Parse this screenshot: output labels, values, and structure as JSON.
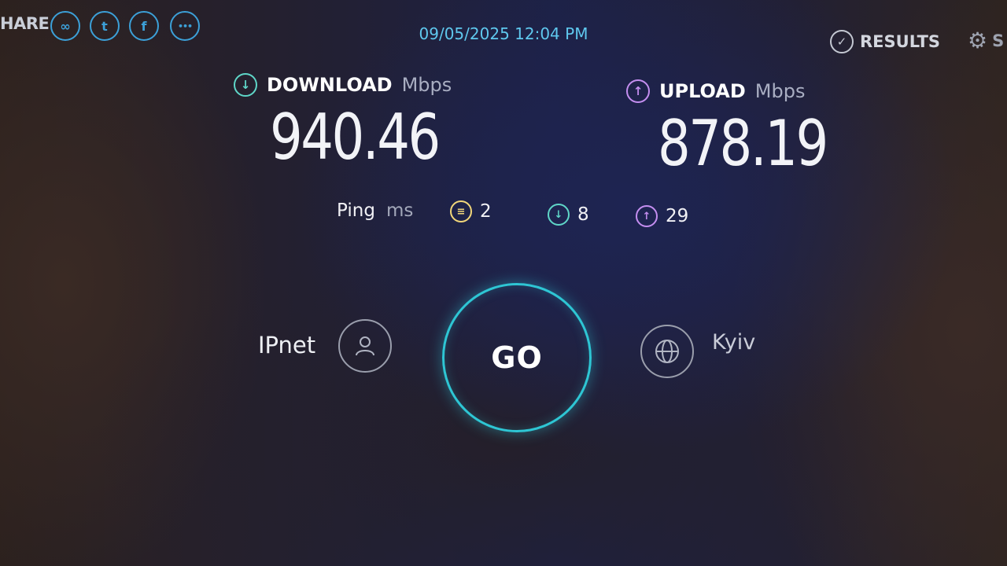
{
  "header": {
    "share_label": "HARE",
    "share_icons": [
      {
        "name": "link-icon",
        "glyph": "∞"
      },
      {
        "name": "twitter-icon",
        "glyph": "t"
      },
      {
        "name": "facebook-icon",
        "glyph": "f"
      },
      {
        "name": "more-icon",
        "glyph": "•••"
      }
    ],
    "timestamp": "09/05/2025 12:04 PM",
    "results_label": "RESULTS",
    "settings_label": "S"
  },
  "download": {
    "label": "DOWNLOAD",
    "unit": "Mbps",
    "value": "940.46"
  },
  "upload": {
    "label": "UPLOAD",
    "unit": "Mbps",
    "value": "878.19"
  },
  "ping": {
    "label": "Ping",
    "unit": "ms",
    "idle": "2",
    "download": "8",
    "upload": "29"
  },
  "server": {
    "provider": "IPnet",
    "go_label": "GO",
    "city": "Kyiv"
  },
  "colors": {
    "download_accent": "#5fd6c8",
    "upload_accent": "#c48ef0",
    "ping_accent": "#f2d77a",
    "go_ring": "#2ec6d4",
    "timestamp": "#5fc8ee"
  }
}
